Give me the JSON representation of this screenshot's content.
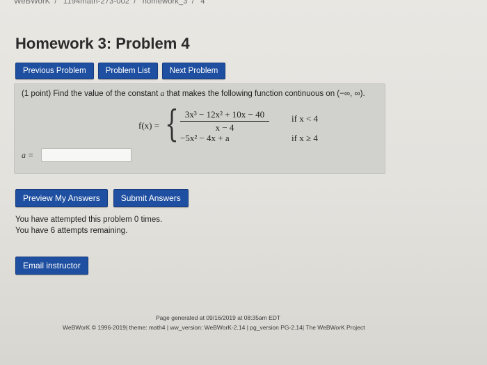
{
  "breadcrumb": [
    "WeBWorK",
    "1194math-273-002",
    "homework_3",
    "4"
  ],
  "page_title": "Homework 3: Problem 4",
  "nav": {
    "previous": "Previous Problem",
    "list": "Problem List",
    "next": "Next Problem"
  },
  "problem": {
    "points": "(1 point)",
    "statement_pre": "Find the value of the constant",
    "statement_var": "a",
    "statement_post": "that makes the following function continuous on (−∞, ∞).",
    "fx": "f(x) =",
    "numerator": "3x³ − 12x² + 10x − 40",
    "denominator": "x − 4",
    "case1_condition": "if x < 4",
    "case2_expression": "−5x² − 4x + a",
    "case2_condition": "if x ≥ 4",
    "answer_label": "a =",
    "answer_value": ""
  },
  "actions": {
    "preview": "Preview My Answers",
    "submit": "Submit Answers"
  },
  "attempts": {
    "line1": "You have attempted this problem 0 times.",
    "line2": "You have 6 attempts remaining."
  },
  "email_button": "Email instructor",
  "footer": {
    "generated": "Page generated at 09/16/2019 at 08:35am EDT",
    "version": "WeBWorK © 1996-2019| theme: math4 | ww_version: WeBWorK-2.14 | pg_version PG-2.14| The WeBWorK Project"
  },
  "colors": {
    "button_bg": "#1f4fa0",
    "panel_bg": "#d1d1cd"
  }
}
